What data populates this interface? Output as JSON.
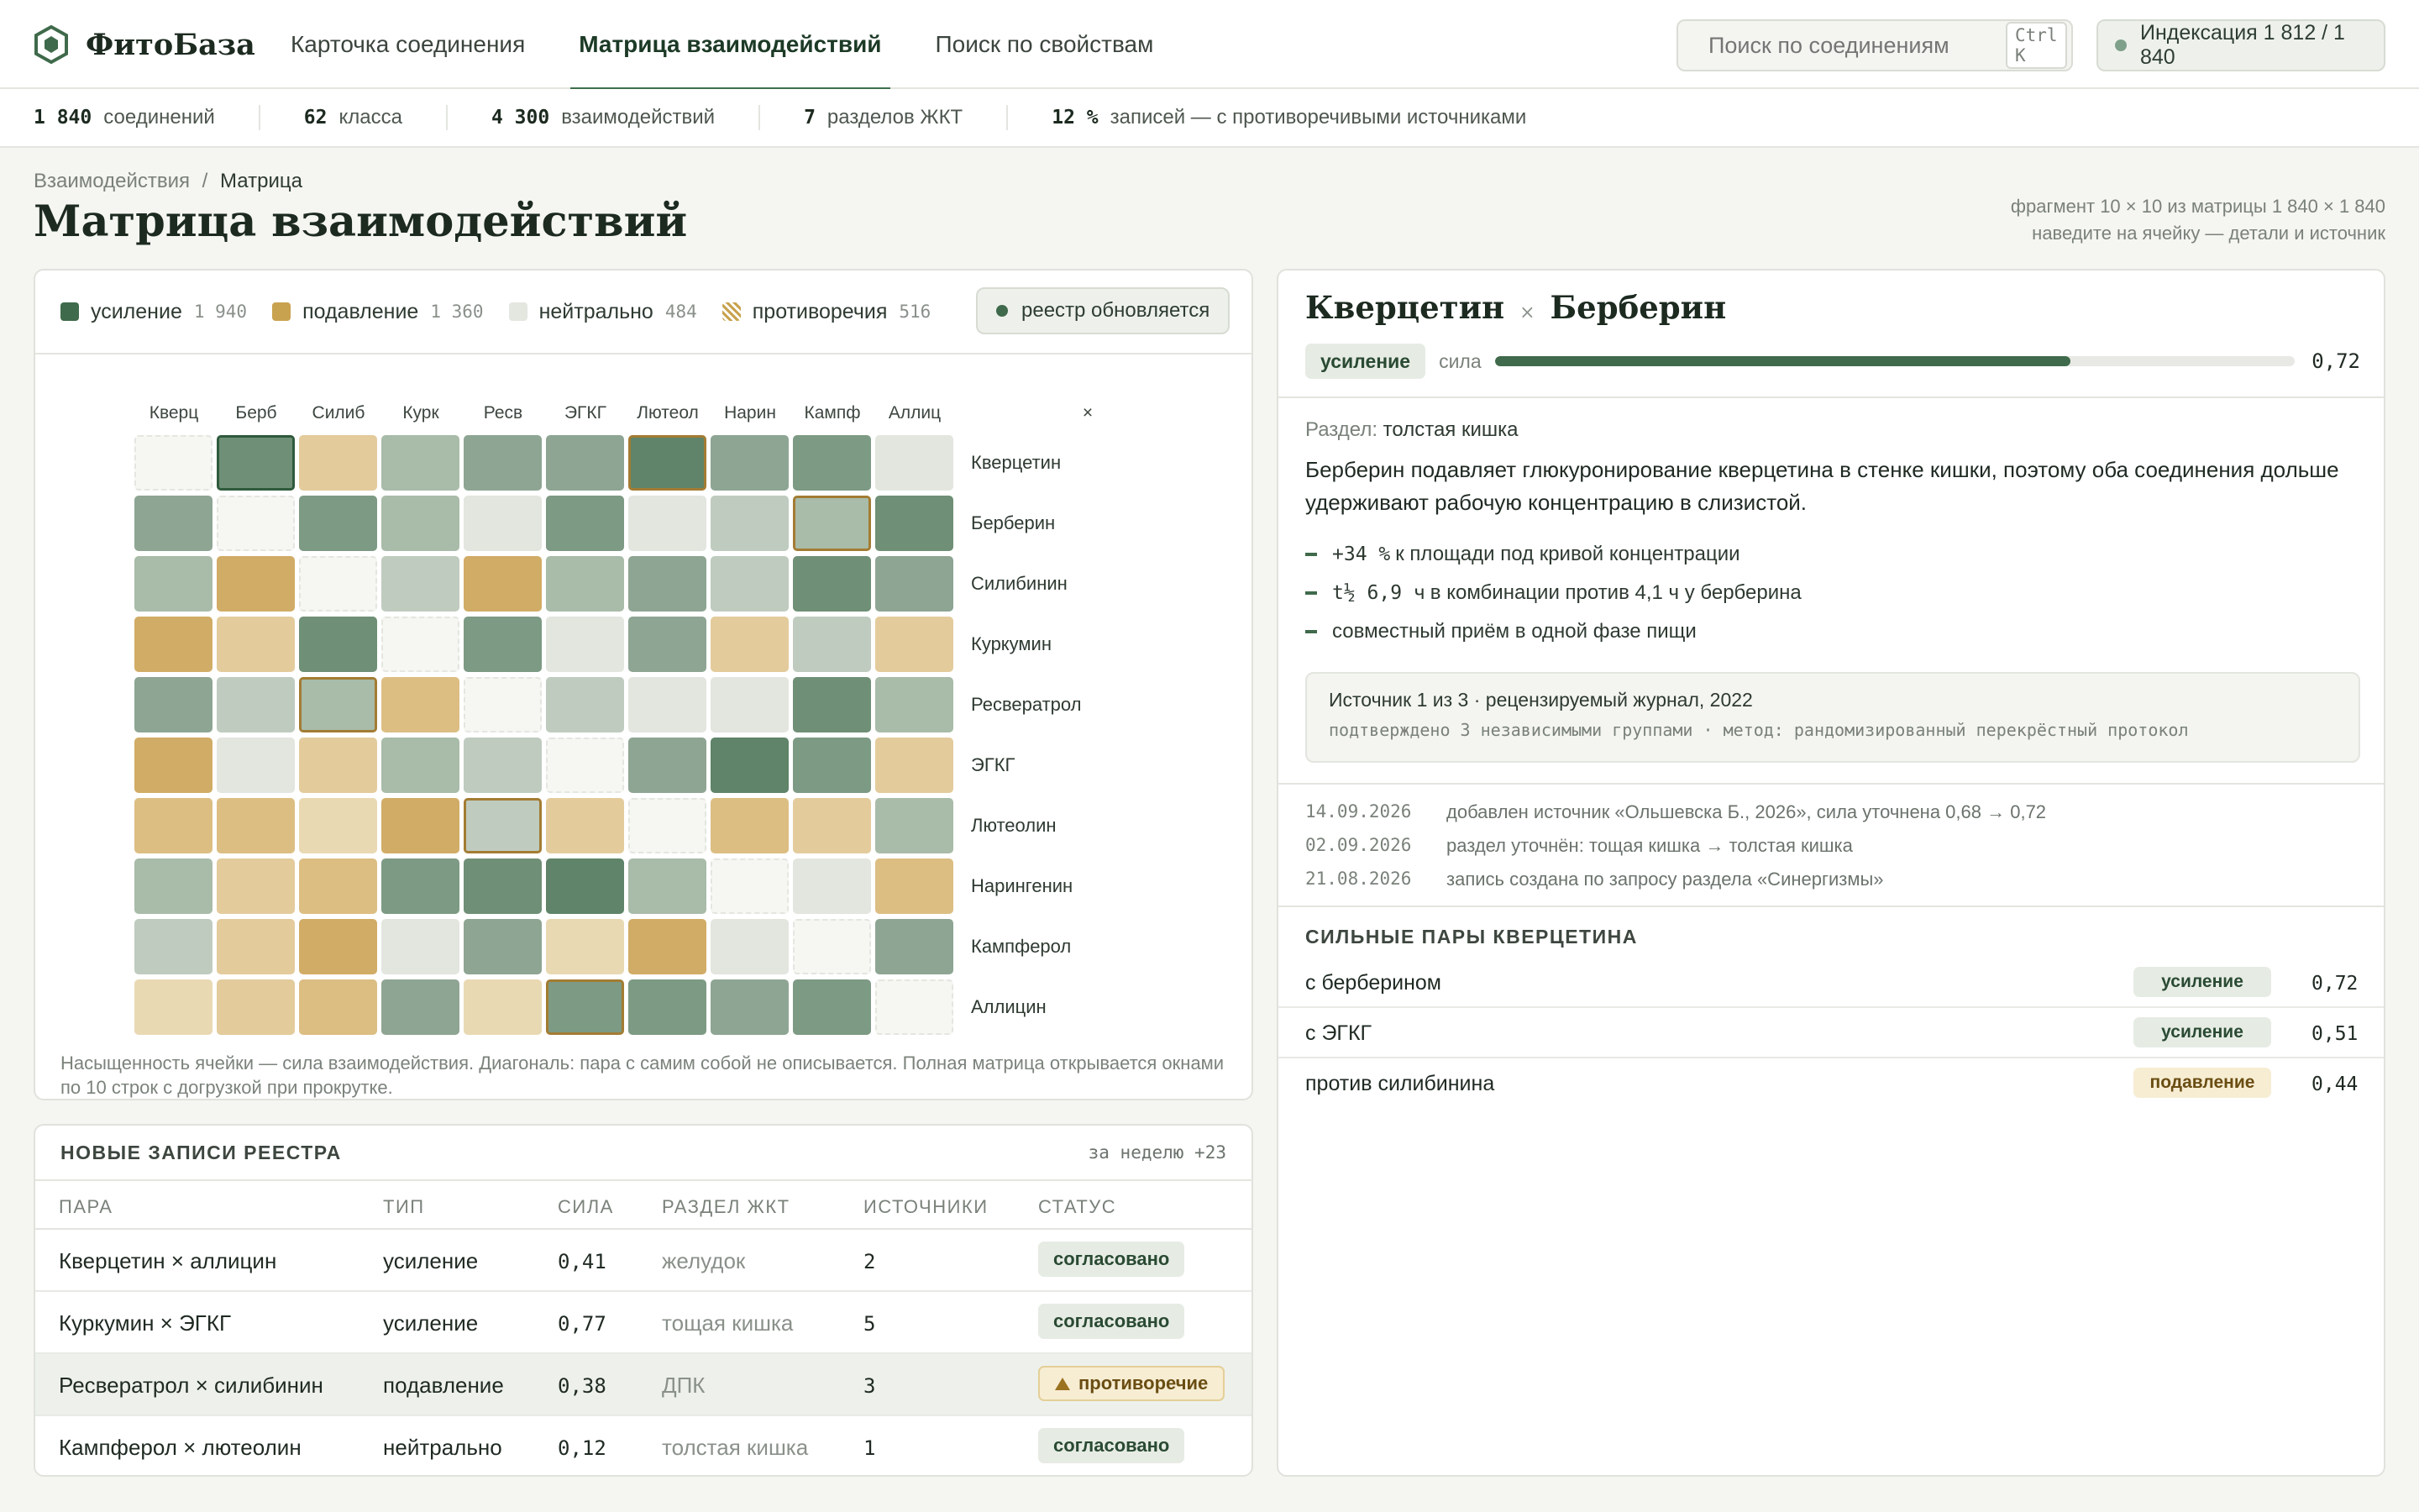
{
  "app": {
    "name": "ФитоБаза"
  },
  "nav": {
    "tabs": [
      {
        "label": "Карточка соединения",
        "active": false
      },
      {
        "label": "Матрица взаимодействий",
        "active": true
      },
      {
        "label": "Поиск по свойствам",
        "active": false
      }
    ]
  },
  "search": {
    "placeholder": "Поиск по соединениям",
    "shortcut": "Ctrl K"
  },
  "index_status": "Индексация 1 812 / 1 840",
  "stats": [
    {
      "value": "1 840",
      "label": "соединений"
    },
    {
      "value": "62",
      "label": "класса"
    },
    {
      "value": "4 300",
      "label": "взаимодействий"
    },
    {
      "value": "7",
      "label": "разделов ЖКТ"
    },
    {
      "value": "12 %",
      "label": "записей — с противоречивыми источниками"
    }
  ],
  "breadcrumb": {
    "parent": "Взаимодействия",
    "sep": "/",
    "current": "Матрица"
  },
  "page_title": "Матрица взаимодействий",
  "page_note": {
    "line1": "фрагмент 10 × 10 из матрицы 1 840 × 1 840",
    "line2": "наведите на ячейку — детали и источник"
  },
  "legend": [
    {
      "label": "усиление",
      "count": "1 940",
      "color": "#3f6a4b"
    },
    {
      "label": "подавление",
      "count": "1 360",
      "color": "#c9a24f"
    },
    {
      "label": "нейтрально",
      "count": "484",
      "color": "#e4e6e0"
    },
    {
      "label": "противоречия",
      "count": "516",
      "color": "hatch"
    }
  ],
  "registry_status": "реестр обновляется",
  "matrix": {
    "corner": "×",
    "col_labels": [
      "Кверц",
      "Берб",
      "Силиб",
      "Курк",
      "Ресв",
      "ЭГКГ",
      "Лютеол",
      "Нарин",
      "Кампф",
      "Аллиц"
    ],
    "row_labels": [
      "Кверцетин",
      "Берберин",
      "Силибинин",
      "Куркумин",
      "Ресвератрол",
      "ЭГКГ",
      "Лютеолин",
      "Нарингенин",
      "Кампферол",
      "Аллицин"
    ],
    "cells": [
      [
        "diag",
        "g5",
        "y2",
        "g2",
        "g3",
        "g3",
        "g6",
        "g3",
        "g4",
        "n"
      ],
      [
        "g3",
        "diag",
        "g4",
        "g2",
        "n",
        "g4",
        "n",
        "g1",
        "g2",
        "g5"
      ],
      [
        "g2",
        "y4",
        "diag",
        "g1",
        "y4",
        "g2",
        "g3",
        "g1",
        "g5",
        "g3"
      ],
      [
        "y4",
        "y2",
        "g5",
        "diag",
        "g4",
        "n",
        "g3",
        "y2",
        "g1",
        "y2"
      ],
      [
        "g3",
        "g1",
        "g2",
        "y3",
        "diag",
        "g1",
        "n",
        "n",
        "g5",
        "g2"
      ],
      [
        "y4",
        "n",
        "y2",
        "g2",
        "g1",
        "diag",
        "g3",
        "g6",
        "g4",
        "y2"
      ],
      [
        "y3",
        "y3",
        "y1",
        "y4",
        "g1",
        "y2",
        "diag",
        "y3",
        "y2",
        "g2"
      ],
      [
        "g2",
        "y2",
        "y3",
        "g4",
        "g5",
        "g6",
        "g2",
        "diag",
        "n",
        "y3"
      ],
      [
        "g1",
        "y2",
        "y4",
        "n",
        "g3",
        "y1",
        "y4",
        "n",
        "diag",
        "g3"
      ],
      [
        "y1",
        "y2",
        "y3",
        "g3",
        "y1",
        "g4",
        "g4",
        "g3",
        "g4",
        "diag"
      ]
    ],
    "selected": [
      0,
      1
    ],
    "flagged": [
      [
        0,
        6
      ],
      [
        1,
        8
      ],
      [
        4,
        2
      ],
      [
        6,
        4
      ],
      [
        9,
        5
      ]
    ]
  },
  "matrix_footer": "Насыщенность ячейки — сила взаимодействия. Диагональ: пара с самим собой не описывается. Полная матрица открывается окнами по 10 строк с догрузкой при прокрутке.",
  "registry": {
    "title": "НОВЫЕ ЗАПИСИ РЕЕСТРА",
    "week": "за неделю +23",
    "headers": [
      "ПАРА",
      "ТИП",
      "СИЛА",
      "РАЗДЕЛ ЖКТ",
      "ИСТОЧНИКИ",
      "СТАТУС"
    ],
    "rows": [
      {
        "pair": "Кверцетин × аллицин",
        "type": "усиление",
        "strength": "0,41",
        "section": "желудок",
        "sources": "2",
        "status": "согласовано",
        "kind": "ok"
      },
      {
        "pair": "Куркумин × ЭГКГ",
        "type": "усиление",
        "strength": "0,77",
        "section": "тощая кишка",
        "sources": "5",
        "status": "согласовано",
        "kind": "ok"
      },
      {
        "pair": "Ресвератрол × силибинин",
        "type": "подавление",
        "strength": "0,38",
        "section": "ДПК",
        "sources": "3",
        "status": "противоречие",
        "kind": "warn"
      },
      {
        "pair": "Кампферол × лютеолин",
        "type": "нейтрально",
        "strength": "0,12",
        "section": "толстая кишка",
        "sources": "1",
        "status": "согласовано",
        "kind": "ok"
      }
    ]
  },
  "detail": {
    "a": "Кверцетин",
    "x": "×",
    "b": "Берберин",
    "type": "усиление",
    "strength_label": "сила",
    "strength": 0.72,
    "strength_text": "0,72",
    "section_label": "Раздел:",
    "section": "толстая кишка",
    "description": "Берберин подавляет глюкуронирование кверцетина в стенке кишки, поэтому оба соединения дольше удерживают рабочую концентрацию в слизистой.",
    "bullets": [
      {
        "mono": "+34 %",
        "text": "к площади под кривой концентрации"
      },
      {
        "mono": "t½ 6,9 ч",
        "text": "в комбинации против 4,1 ч у берберина"
      },
      {
        "mono": "",
        "text": "совместный приём в одной фазе пищи"
      }
    ],
    "source": {
      "line1": "Источник 1 из 3 · рецензируемый журнал, 2022",
      "line2": "подтверждено 3 независимыми группами · метод: рандомизированный перекрёстный протокол"
    },
    "log": [
      {
        "date": "14.09.2026",
        "text": "добавлен источник «Ольшевска Б., 2026», сила уточнена 0,68 → 0,72"
      },
      {
        "date": "02.09.2026",
        "text": "раздел уточнён: тощая кишка → толстая кишка"
      },
      {
        "date": "21.08.2026",
        "text": "запись создана по запросу раздела «Синергизмы»"
      }
    ],
    "pairs_title": "СИЛЬНЫЕ ПАРЫ КВЕРЦЕТИНА",
    "pairs": [
      {
        "name": "с берберином",
        "type": "усиление",
        "kind": "up",
        "value": "0,72"
      },
      {
        "name": "с ЭГКГ",
        "type": "усиление",
        "kind": "up",
        "value": "0,51"
      },
      {
        "name": "против силибинина",
        "type": "подавление",
        "kind": "dn",
        "value": "0,44"
      }
    ]
  }
}
